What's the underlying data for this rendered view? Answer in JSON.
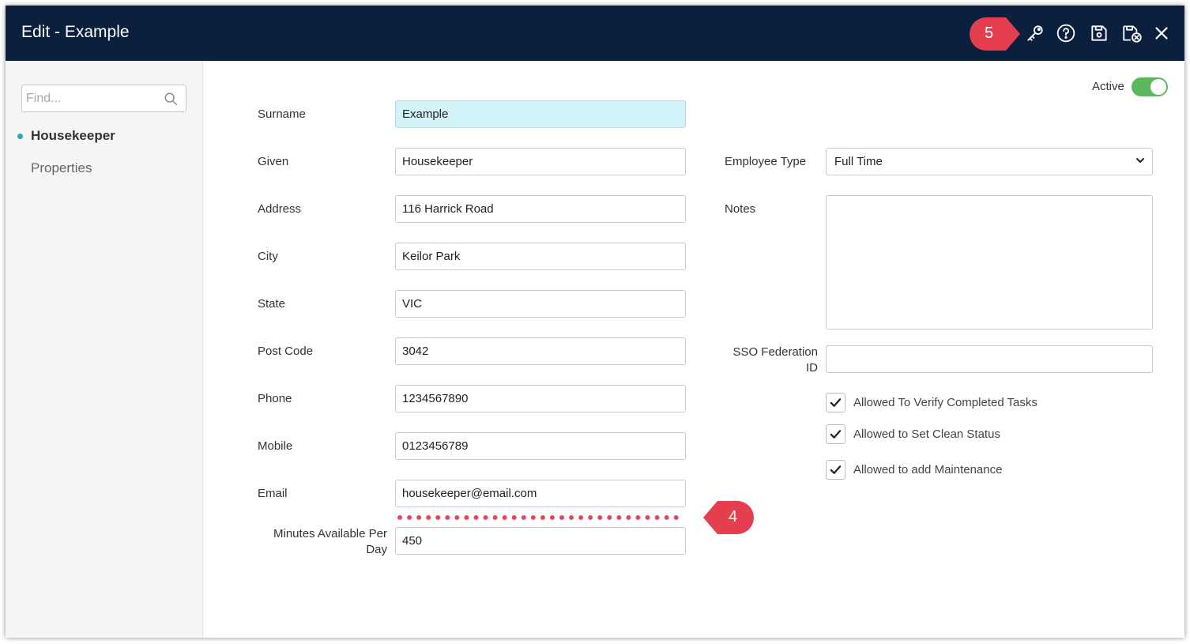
{
  "window": {
    "title": "Edit - Example"
  },
  "toolbar": {
    "icons": [
      "key-icon",
      "help-icon",
      "save-icon",
      "save-close-icon",
      "close-icon"
    ],
    "callout_label": "5"
  },
  "sidebar": {
    "search_placeholder": "Find...",
    "items": [
      {
        "label": "Housekeeper",
        "active": true
      },
      {
        "label": "Properties",
        "active": false
      }
    ]
  },
  "form": {
    "active_label": "Active",
    "active_on": true,
    "surname": {
      "label": "Surname",
      "value": "Example"
    },
    "given": {
      "label": "Given",
      "value": "Housekeeper"
    },
    "address": {
      "label": "Address",
      "value": "116 Harrick Road"
    },
    "city": {
      "label": "City",
      "value": "Keilor Park"
    },
    "state": {
      "label": "State",
      "value": "VIC"
    },
    "post_code": {
      "label": "Post Code",
      "value": "3042"
    },
    "phone": {
      "label": "Phone",
      "value": "1234567890"
    },
    "mobile": {
      "label": "Mobile",
      "value": "0123456789"
    },
    "email": {
      "label": "Email",
      "value": "housekeeper@email.com"
    },
    "minutes": {
      "label_line1": "Minutes Available Per",
      "label_line2": "Day",
      "value": "450"
    },
    "employee_type": {
      "label": "Employee Type",
      "value": "Full Time"
    },
    "notes": {
      "label": "Notes",
      "value": ""
    },
    "sso": {
      "label_line1": "SSO Federation",
      "label_line2": "ID",
      "value": ""
    },
    "checkboxes": [
      {
        "label": "Allowed To Verify Completed Tasks",
        "checked": true
      },
      {
        "label": "Allowed to Set Clean Status",
        "checked": true
      },
      {
        "label": "Allowed to add Maintenance",
        "checked": true
      }
    ],
    "callout_label": "4"
  },
  "colors": {
    "titlebar": "#0b1f3f",
    "callout": "#e53e4f",
    "toggle_on": "#5cb85c",
    "accent": "#24a7c2",
    "highlight_field": "#d3f4f8"
  }
}
